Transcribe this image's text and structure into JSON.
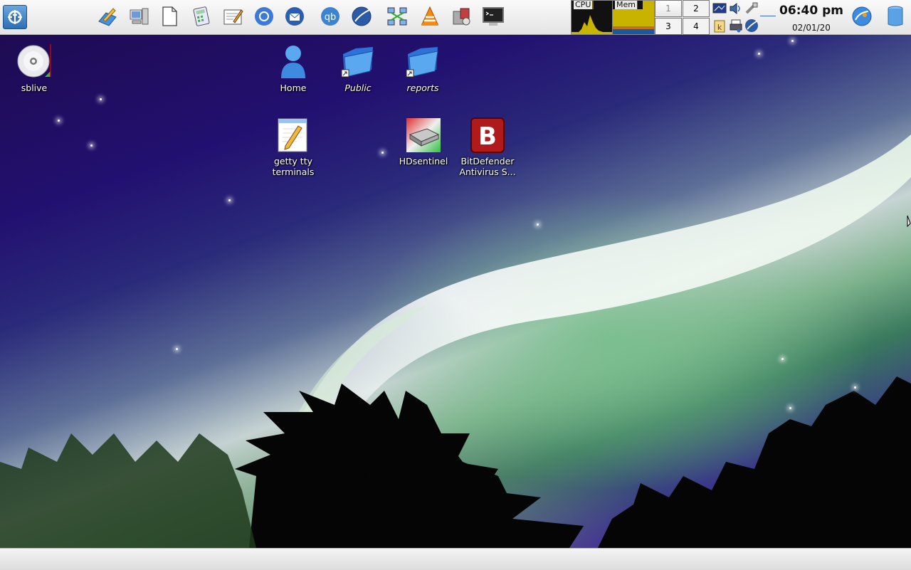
{
  "top_panel": {
    "launchers": [
      {
        "name": "kde-edit-icon"
      },
      {
        "name": "system-settings-icon"
      },
      {
        "name": "blank-document-icon"
      },
      {
        "name": "calculator-icon"
      },
      {
        "name": "text-editor-icon"
      },
      {
        "name": "chromium-icon"
      },
      {
        "name": "thunderbird-icon"
      },
      {
        "name": "qbittorrent-icon"
      },
      {
        "name": "network-globe-icon"
      },
      {
        "name": "network-manager-icon"
      },
      {
        "name": "vlc-icon"
      },
      {
        "name": "package-manager-icon"
      },
      {
        "name": "terminal-icon"
      }
    ],
    "monitor": {
      "cpu_label": "CPU",
      "mem_label": "Mem"
    },
    "pager": [
      "1",
      "2",
      "3",
      "4"
    ],
    "clock": {
      "time": "06:40 pm",
      "date": "02/01/20"
    }
  },
  "desktop_icons": [
    {
      "label": "sblive"
    },
    {
      "label": "Home"
    },
    {
      "label": "Public"
    },
    {
      "label": "reports"
    },
    {
      "label": "getty tty terminals"
    },
    {
      "label": "HDsentinel"
    },
    {
      "label": "BitDefender Antivirus S..."
    }
  ],
  "colors": {
    "panel": "#e8e8e8",
    "accent": "#2d6fb4",
    "bitdefender": "#b01a1a",
    "monitor_fill": "#c8b400"
  }
}
